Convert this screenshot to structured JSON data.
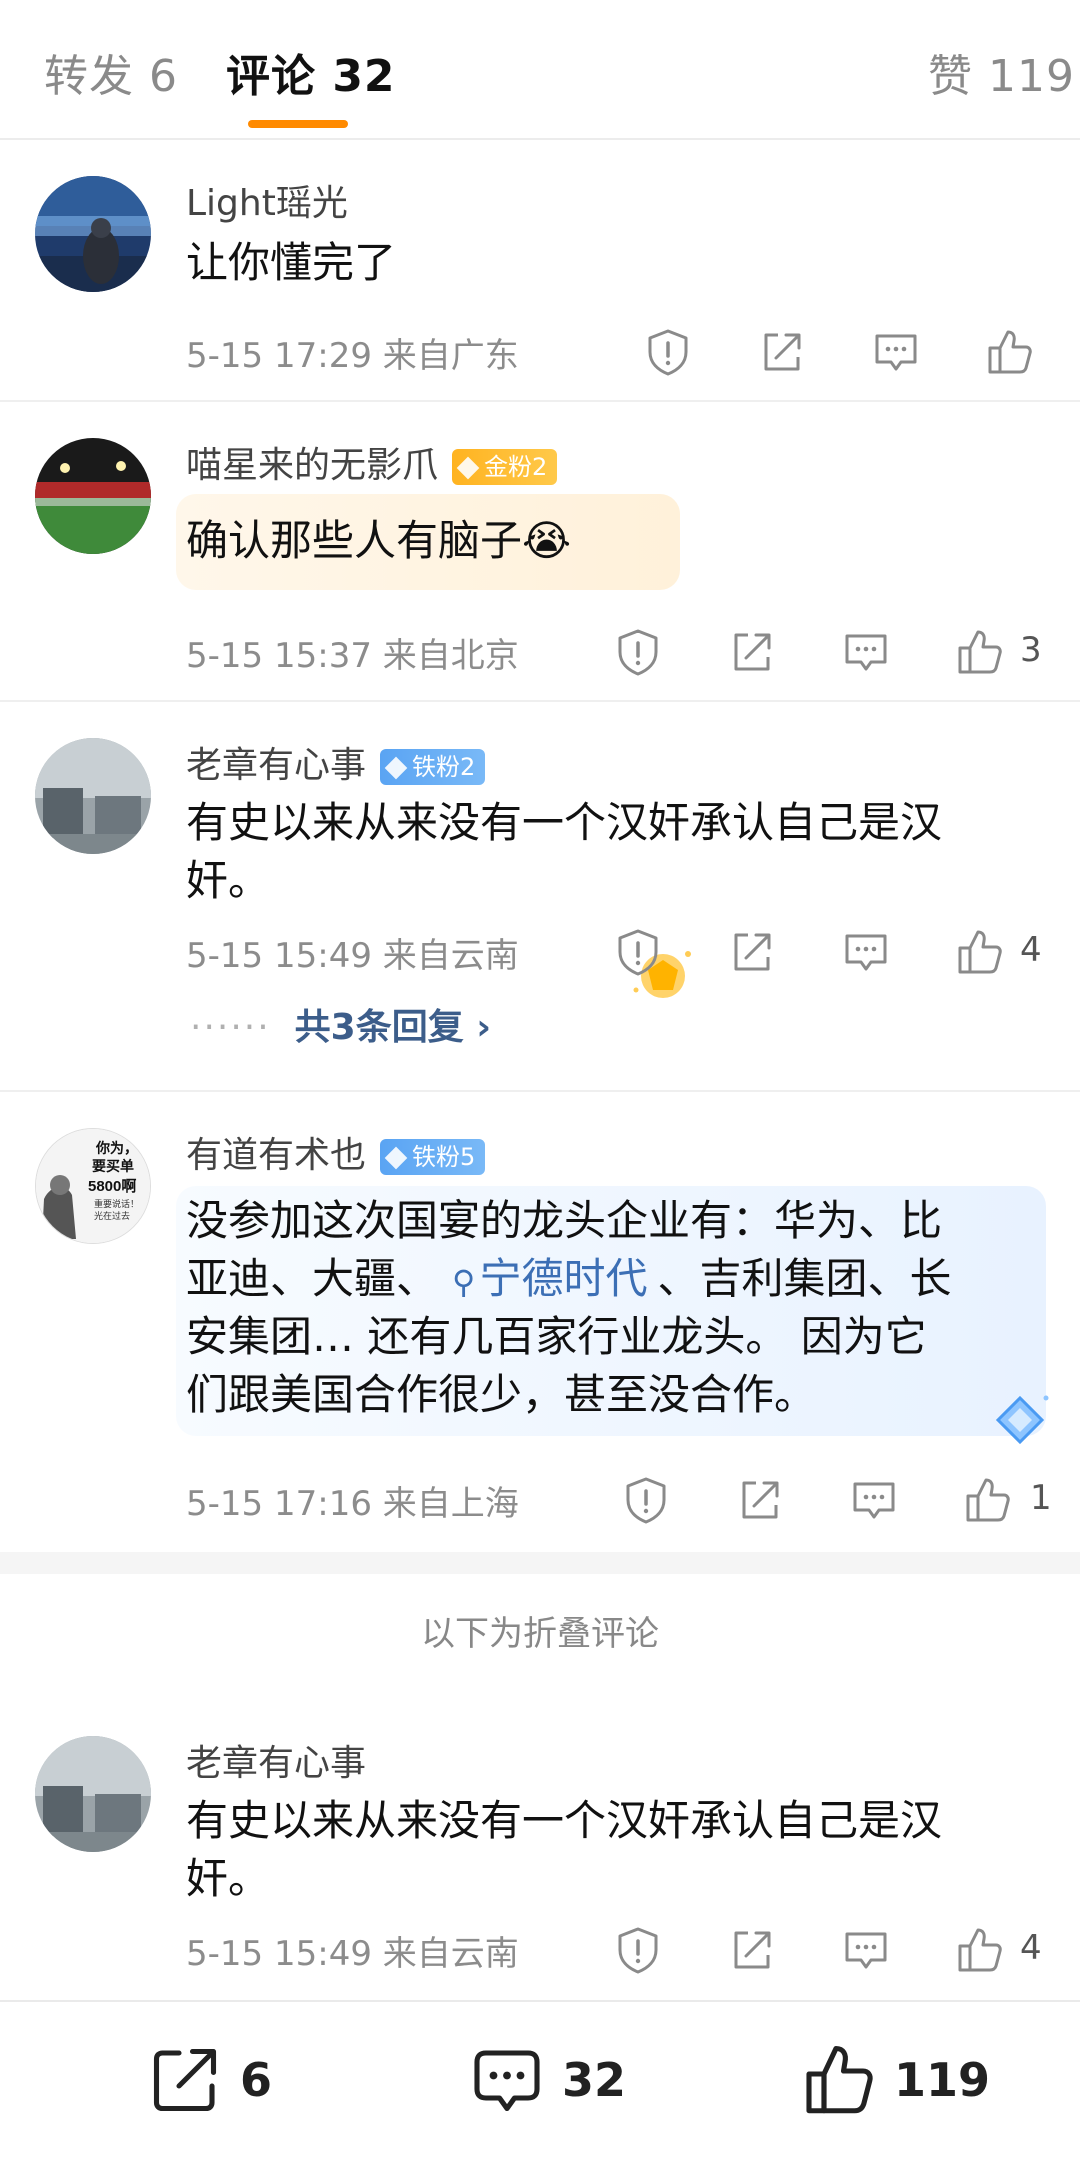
{
  "tabs": {
    "repost": "转发 6",
    "comments": "评论 32",
    "likes": "赞 119"
  },
  "comments": [
    {
      "username": "Light瑶光",
      "badge": "",
      "text": "让你懂完了",
      "meta": "5-15 17:29  来自广东",
      "likes": ""
    },
    {
      "username": "喵星来的无影爪",
      "badge": "金粉2",
      "text": "确认那些人有脑子😭",
      "meta": "5-15 15:37  来自北京",
      "likes": "3"
    },
    {
      "username": "老章有心事",
      "badge": "铁粉2",
      "text_line1": "有史以来从来没有一个汉奸承认自己是汉",
      "text_line2": "奸。",
      "meta": "5-15 15:49  来自云南",
      "likes": "4",
      "replies_dots": "······",
      "replies": "共3条回复 ›"
    },
    {
      "username": "有道有术也",
      "badge": "铁粉5",
      "line1": "没参加这次国宴的龙头企业有：华为、比",
      "line2_a": "亚迪、大疆、",
      "hashtag": "宁德时代",
      "line2_b": "、吉利集团、长",
      "line3": "安集团… 还有几百家行业龙头。 因为它",
      "line4": "们跟美国合作很少，甚至没合作。",
      "meta": "5-15 17:16  来自上海",
      "likes": "1",
      "avatar_text": [
        "你为，",
        "要买单",
        "5800啊",
        "重要说话！",
        "光在过去"
      ]
    }
  ],
  "folded_label": "以下为折叠评论",
  "folded_comment": {
    "username": "老章有心事",
    "text_line1": "有史以来从来没有一个汉奸承认自己是汉",
    "text_line2": "奸。",
    "meta": "5-15 15:49  来自云南",
    "likes": "4"
  },
  "bottom_bar": {
    "share_count": "6",
    "comment_count": "32",
    "like_count": "119"
  },
  "colors": {
    "accent": "#ff8a00",
    "link": "#3c5d8a",
    "gold_badge": "#ffb320",
    "iron_badge": "#5aa4f3"
  }
}
